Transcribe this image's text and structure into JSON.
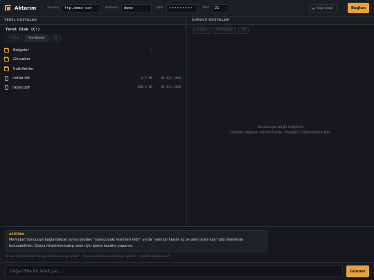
{
  "app": {
    "title": "Aktarım",
    "accent": "#e7a33d"
  },
  "connection": {
    "host_label": "Sunucu",
    "host_value": "ftp.demo-sar",
    "user_label": "Kullanıcı",
    "user_value": "demo",
    "pass_label": "Şifre",
    "pass_value": "•••••••••",
    "port_label": "Port",
    "port_value": "21",
    "status_text": "Bağlı değil",
    "connect_label": "Bağlan"
  },
  "local": {
    "header": "YEREL DOSYALAR",
    "path": "Yerel Disk (C:)",
    "nav": {
      "back": "← Geri",
      "new_folder": "Yeni Klasör",
      "delete": "Sil"
    },
    "files": [
      {
        "type": "folder",
        "name": "Belgeler",
        "size": "—",
        "date": ""
      },
      {
        "type": "folder",
        "name": "Görseller",
        "size": "—",
        "date": ""
      },
      {
        "type": "folder",
        "name": "İndirilenler",
        "size": "—",
        "date": ""
      },
      {
        "type": "file",
        "name": "notlar.txt",
        "size": "2.3 KB",
        "date": "04 Eyl 2026"
      },
      {
        "type": "file",
        "name": "rapor.pdf",
        "size": "500.3 KB",
        "date": "02 Eyl 2026"
      }
    ]
  },
  "remote": {
    "header": "SUNUCU DOSYALARI",
    "nav": {
      "back": "← Geri",
      "new_folder": "Yeni Klasör",
      "delete": "Sil"
    },
    "empty_line1": "Sunucuya bağlı değilsin.",
    "empty_line2": "Üstteki bilgileri kontrol edip \"Bağlan\" düğmesine bas."
  },
  "assistant": {
    "label": "ASİSTAN",
    "message": "Merhaba! Sunucuya bağlandıktan sonra benden \"sunucudaki resimleri indir\" ya da \"yeni bir klasör aç ve adını arşiv koy\" gibi isteklerde bulunabilirsin. Dosya listelerine bakıp senin için işlemi kendim yaparım.",
    "examples": "Örnek: \"yerel diskteki tüm görselleri sunucuya yükle\" · \"backup klasörünün içindekileri göster\" · \"readme dosyasını sil\""
  },
  "composer": {
    "placeholder": "Doğal dille bir istek yaz...",
    "send_label": "Gönder"
  }
}
